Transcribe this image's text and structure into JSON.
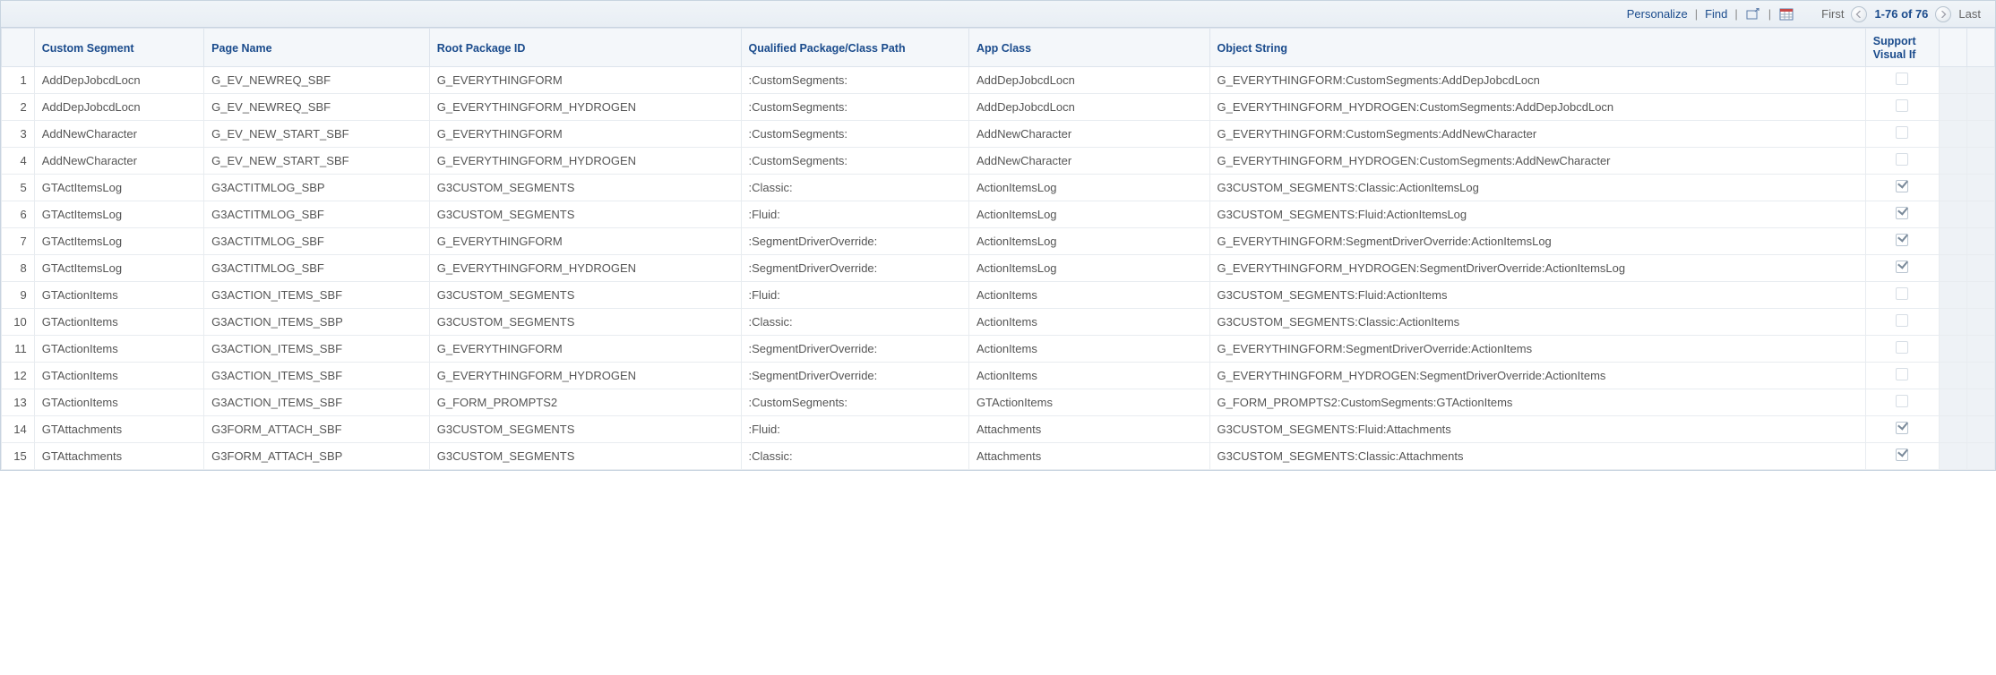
{
  "toolbar": {
    "personalize": "Personalize",
    "find": "Find",
    "first": "First",
    "last": "Last",
    "range": "1-76 of 76"
  },
  "headers": {
    "customSegment": "Custom Segment",
    "pageName": "Page Name",
    "rootPackageId": "Root Package ID",
    "qualifiedPath": "Qualified Package/Class Path",
    "appClass": "App Class",
    "objectString": "Object String",
    "supportVisualIf": "Support Visual If"
  },
  "rows": [
    {
      "n": "1",
      "seg": "AddDepJobcdLocn",
      "page": "G_EV_NEWREQ_SBF",
      "root": "G_EVERYTHINGFORM",
      "path": ":CustomSegments:",
      "app": "AddDepJobcdLocn",
      "obj": "G_EVERYTHINGFORM:CustomSegments:AddDepJobcdLocn",
      "sup": false
    },
    {
      "n": "2",
      "seg": "AddDepJobcdLocn",
      "page": "G_EV_NEWREQ_SBF",
      "root": "G_EVERYTHINGFORM_HYDROGEN",
      "path": ":CustomSegments:",
      "app": "AddDepJobcdLocn",
      "obj": "G_EVERYTHINGFORM_HYDROGEN:CustomSegments:AddDepJobcdLocn",
      "sup": false
    },
    {
      "n": "3",
      "seg": "AddNewCharacter",
      "page": "G_EV_NEW_START_SBF",
      "root": "G_EVERYTHINGFORM",
      "path": ":CustomSegments:",
      "app": "AddNewCharacter",
      "obj": "G_EVERYTHINGFORM:CustomSegments:AddNewCharacter",
      "sup": false
    },
    {
      "n": "4",
      "seg": "AddNewCharacter",
      "page": "G_EV_NEW_START_SBF",
      "root": "G_EVERYTHINGFORM_HYDROGEN",
      "path": ":CustomSegments:",
      "app": "AddNewCharacter",
      "obj": "G_EVERYTHINGFORM_HYDROGEN:CustomSegments:AddNewCharacter",
      "sup": false
    },
    {
      "n": "5",
      "seg": "GTActItemsLog",
      "page": "G3ACTITMLOG_SBP",
      "root": "G3CUSTOM_SEGMENTS",
      "path": ":Classic:",
      "app": "ActionItemsLog",
      "obj": "G3CUSTOM_SEGMENTS:Classic:ActionItemsLog",
      "sup": true
    },
    {
      "n": "6",
      "seg": "GTActItemsLog",
      "page": "G3ACTITMLOG_SBF",
      "root": "G3CUSTOM_SEGMENTS",
      "path": ":Fluid:",
      "app": "ActionItemsLog",
      "obj": "G3CUSTOM_SEGMENTS:Fluid:ActionItemsLog",
      "sup": true
    },
    {
      "n": "7",
      "seg": "GTActItemsLog",
      "page": "G3ACTITMLOG_SBF",
      "root": "G_EVERYTHINGFORM",
      "path": ":SegmentDriverOverride:",
      "app": "ActionItemsLog",
      "obj": "G_EVERYTHINGFORM:SegmentDriverOverride:ActionItemsLog",
      "sup": true
    },
    {
      "n": "8",
      "seg": "GTActItemsLog",
      "page": "G3ACTITMLOG_SBF",
      "root": "G_EVERYTHINGFORM_HYDROGEN",
      "path": ":SegmentDriverOverride:",
      "app": "ActionItemsLog",
      "obj": "G_EVERYTHINGFORM_HYDROGEN:SegmentDriverOverride:ActionItemsLog",
      "sup": true
    },
    {
      "n": "9",
      "seg": "GTActionItems",
      "page": "G3ACTION_ITEMS_SBF",
      "root": "G3CUSTOM_SEGMENTS",
      "path": ":Fluid:",
      "app": "ActionItems",
      "obj": "G3CUSTOM_SEGMENTS:Fluid:ActionItems",
      "sup": false
    },
    {
      "n": "10",
      "seg": "GTActionItems",
      "page": "G3ACTION_ITEMS_SBP",
      "root": "G3CUSTOM_SEGMENTS",
      "path": ":Classic:",
      "app": "ActionItems",
      "obj": "G3CUSTOM_SEGMENTS:Classic:ActionItems",
      "sup": false
    },
    {
      "n": "11",
      "seg": "GTActionItems",
      "page": "G3ACTION_ITEMS_SBF",
      "root": "G_EVERYTHINGFORM",
      "path": ":SegmentDriverOverride:",
      "app": "ActionItems",
      "obj": "G_EVERYTHINGFORM:SegmentDriverOverride:ActionItems",
      "sup": false
    },
    {
      "n": "12",
      "seg": "GTActionItems",
      "page": "G3ACTION_ITEMS_SBF",
      "root": "G_EVERYTHINGFORM_HYDROGEN",
      "path": ":SegmentDriverOverride:",
      "app": "ActionItems",
      "obj": "G_EVERYTHINGFORM_HYDROGEN:SegmentDriverOverride:ActionItems",
      "sup": false
    },
    {
      "n": "13",
      "seg": "GTActionItems",
      "page": "G3ACTION_ITEMS_SBF",
      "root": "G_FORM_PROMPTS2",
      "path": ":CustomSegments:",
      "app": "GTActionItems",
      "obj": "G_FORM_PROMPTS2:CustomSegments:GTActionItems",
      "sup": false
    },
    {
      "n": "14",
      "seg": "GTAttachments",
      "page": "G3FORM_ATTACH_SBF",
      "root": "G3CUSTOM_SEGMENTS",
      "path": ":Fluid:",
      "app": "Attachments",
      "obj": "G3CUSTOM_SEGMENTS:Fluid:Attachments",
      "sup": true
    },
    {
      "n": "15",
      "seg": "GTAttachments",
      "page": "G3FORM_ATTACH_SBP",
      "root": "G3CUSTOM_SEGMENTS",
      "path": ":Classic:",
      "app": "Attachments",
      "obj": "G3CUSTOM_SEGMENTS:Classic:Attachments",
      "sup": true
    }
  ]
}
